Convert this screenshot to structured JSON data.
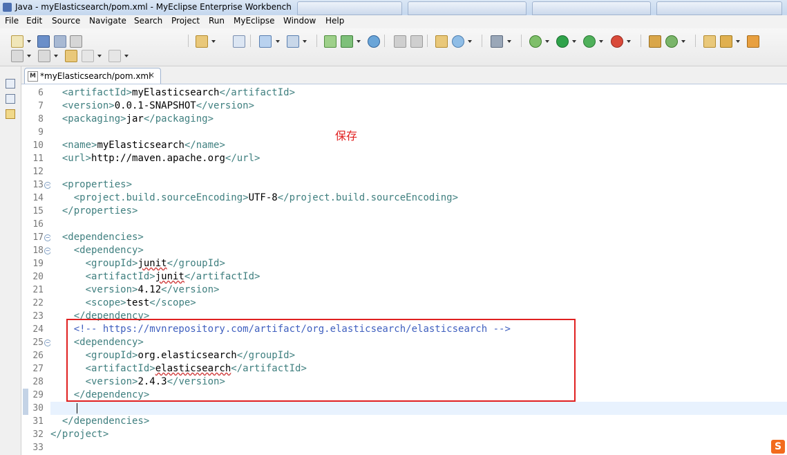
{
  "window": {
    "title": "Java - myElasticsearch/pom.xml - MyEclipse Enterprise Workbench"
  },
  "menubar": {
    "items": [
      "File",
      "Edit",
      "Source",
      "Navigate",
      "Search",
      "Project",
      "Run",
      "MyEclipse",
      "Window",
      "Help"
    ]
  },
  "editor": {
    "tab_title": "*myElasticsearch/pom.xml",
    "tab_file_icon": "M",
    "current_line": 30,
    "lines": [
      {
        "num": "6",
        "fold": false,
        "parts": [
          [
            "tag",
            "  <artifactId>"
          ],
          [
            "txt",
            "myElasticsearch"
          ],
          [
            "tag",
            "</artifactId>"
          ]
        ]
      },
      {
        "num": "7",
        "fold": false,
        "parts": [
          [
            "tag",
            "  <version>"
          ],
          [
            "txt",
            "0.0.1-SNAPSHOT"
          ],
          [
            "tag",
            "</version>"
          ]
        ]
      },
      {
        "num": "8",
        "fold": false,
        "parts": [
          [
            "tag",
            "  <packaging>"
          ],
          [
            "txt",
            "jar"
          ],
          [
            "tag",
            "</packaging>"
          ]
        ]
      },
      {
        "num": "9",
        "fold": false,
        "parts": []
      },
      {
        "num": "10",
        "fold": false,
        "parts": [
          [
            "tag",
            "  <name>"
          ],
          [
            "txt",
            "myElasticsearch"
          ],
          [
            "tag",
            "</name>"
          ]
        ]
      },
      {
        "num": "11",
        "fold": false,
        "parts": [
          [
            "tag",
            "  <url>"
          ],
          [
            "txt",
            "http://maven.apache.org"
          ],
          [
            "tag",
            "</url>"
          ]
        ]
      },
      {
        "num": "12",
        "fold": false,
        "parts": []
      },
      {
        "num": "13",
        "fold": true,
        "parts": [
          [
            "tag",
            "  <properties>"
          ]
        ]
      },
      {
        "num": "14",
        "fold": false,
        "parts": [
          [
            "tag",
            "    <project.build.sourceEncoding>"
          ],
          [
            "txt",
            "UTF-8"
          ],
          [
            "tag",
            "</project.build.sourceEncoding>"
          ]
        ]
      },
      {
        "num": "15",
        "fold": false,
        "parts": [
          [
            "tag",
            "  </properties>"
          ]
        ]
      },
      {
        "num": "16",
        "fold": false,
        "parts": []
      },
      {
        "num": "17",
        "fold": true,
        "parts": [
          [
            "tag",
            "  <dependencies>"
          ]
        ]
      },
      {
        "num": "18",
        "fold": true,
        "parts": [
          [
            "tag",
            "    <dependency>"
          ]
        ]
      },
      {
        "num": "19",
        "fold": false,
        "parts": [
          [
            "tag",
            "      <groupId>"
          ],
          [
            "squig",
            "junit"
          ],
          [
            "tag",
            "</groupId>"
          ]
        ]
      },
      {
        "num": "20",
        "fold": false,
        "parts": [
          [
            "tag",
            "      <artifactId>"
          ],
          [
            "squig",
            "junit"
          ],
          [
            "tag",
            "</artifactId>"
          ]
        ]
      },
      {
        "num": "21",
        "fold": false,
        "parts": [
          [
            "tag",
            "      <version>"
          ],
          [
            "txt",
            "4.12"
          ],
          [
            "tag",
            "</version>"
          ]
        ]
      },
      {
        "num": "22",
        "fold": false,
        "parts": [
          [
            "tag",
            "      <scope>"
          ],
          [
            "txt",
            "test"
          ],
          [
            "tag",
            "</scope>"
          ]
        ]
      },
      {
        "num": "23",
        "fold": false,
        "parts": [
          [
            "tag",
            "    </dependency>"
          ]
        ]
      },
      {
        "num": "24",
        "fold": false,
        "parts": [
          [
            "cmt",
            "    <!-- https://mvnrepository.com/artifact/org.elasticsearch/elasticsearch -->"
          ]
        ]
      },
      {
        "num": "25",
        "fold": true,
        "parts": [
          [
            "tag",
            "    <dependency>"
          ]
        ]
      },
      {
        "num": "26",
        "fold": false,
        "parts": [
          [
            "tag",
            "      <groupId>"
          ],
          [
            "txt",
            "org.elasticsearch"
          ],
          [
            "tag",
            "</groupId>"
          ]
        ]
      },
      {
        "num": "27",
        "fold": false,
        "parts": [
          [
            "tag",
            "      <artifactId>"
          ],
          [
            "squig",
            "elasticsearch"
          ],
          [
            "tag",
            "</artifactId>"
          ]
        ]
      },
      {
        "num": "28",
        "fold": false,
        "parts": [
          [
            "tag",
            "      <version>"
          ],
          [
            "txt",
            "2.4.3"
          ],
          [
            "tag",
            "</version>"
          ]
        ]
      },
      {
        "num": "29",
        "fold": false,
        "parts": [
          [
            "tag",
            "    </dependency>"
          ]
        ]
      },
      {
        "num": "30",
        "fold": false,
        "parts": []
      },
      {
        "num": "31",
        "fold": false,
        "parts": [
          [
            "tag",
            "  </dependencies>"
          ]
        ]
      },
      {
        "num": "32",
        "fold": false,
        "parts": [
          [
            "tag",
            "</project>"
          ]
        ]
      },
      {
        "num": "33",
        "fold": false,
        "parts": []
      }
    ]
  },
  "annotation": {
    "text": "保存",
    "color": "#e02020"
  },
  "tray": {
    "ime_icon": "S"
  },
  "colors": {
    "tag": "#3f7f7f",
    "comment": "#3f5fbf",
    "current_line_bg": "#e8f2fe"
  }
}
